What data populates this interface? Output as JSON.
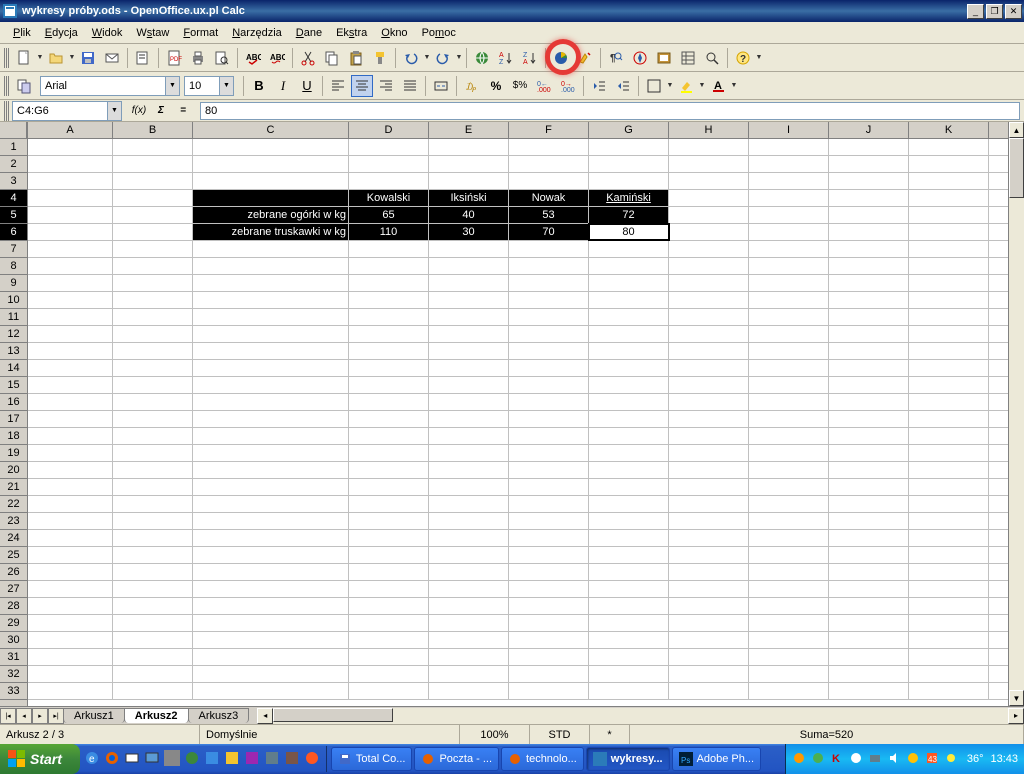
{
  "window": {
    "title": "wykresy próby.ods - OpenOffice.ux.pl Calc"
  },
  "menu": [
    "Plik",
    "Edycja",
    "Widok",
    "Wstaw",
    "Format",
    "Narzędzia",
    "Dane",
    "Ekstra",
    "Okno",
    "Pomoc"
  ],
  "format": {
    "font": "Arial",
    "size": "10"
  },
  "namebox": "C4:G6",
  "formula": "80",
  "columns": [
    "A",
    "B",
    "C",
    "D",
    "E",
    "F",
    "G",
    "H",
    "I",
    "J",
    "K"
  ],
  "rows": 33,
  "selected_rows": [
    4,
    5,
    6
  ],
  "cells": {
    "r4": {
      "D": "Kowalski",
      "E": "Iksiński",
      "F": "Nowak",
      "G": "Kamiński"
    },
    "r5": {
      "C": "zebrane ogórki w kg",
      "D": "65",
      "E": "40",
      "F": "53",
      "G": "72"
    },
    "r6": {
      "C": "zebrane truskawki w kg",
      "D": "110",
      "E": "30",
      "F": "70",
      "G": "80"
    }
  },
  "chart_data": {
    "type": "table",
    "title": "",
    "categories": [
      "Kowalski",
      "Iksiński",
      "Nowak",
      "Kamiński"
    ],
    "series": [
      {
        "name": "zebrane ogórki w kg",
        "values": [
          65,
          40,
          53,
          72
        ]
      },
      {
        "name": "zebrane truskawki w kg",
        "values": [
          110,
          30,
          70,
          80
        ]
      }
    ]
  },
  "tabs": [
    "Arkusz1",
    "Arkusz2",
    "Arkusz3"
  ],
  "active_tab": 1,
  "status": {
    "sheet": "Arkusz 2 / 3",
    "style": "Domyślnie",
    "zoom": "100%",
    "ins": "STD",
    "mod": "*",
    "sum": "Suma=520"
  },
  "taskbar": {
    "start": "Start",
    "items": [
      "Total Co...",
      "Poczta - ...",
      "technolo...",
      "wykresy...",
      "Adobe Ph..."
    ],
    "active": 3,
    "temp": "36°",
    "clock": "13:43"
  }
}
